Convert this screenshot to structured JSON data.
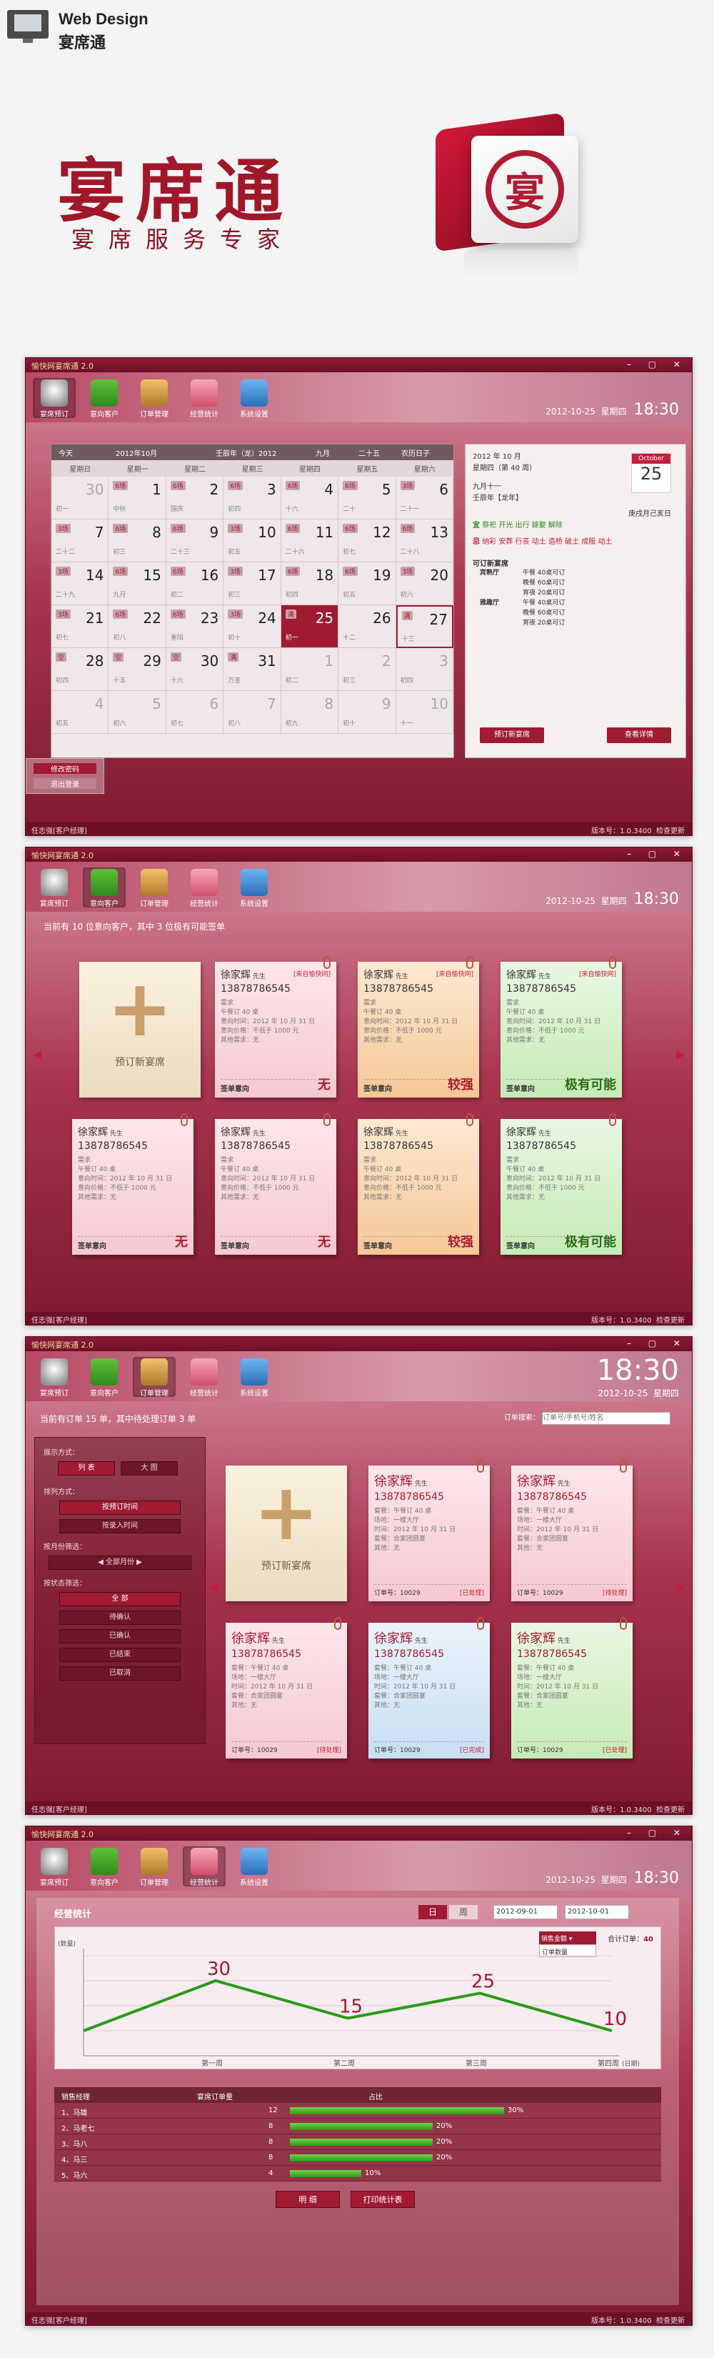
{
  "header": {
    "brand": "Web Design",
    "name": "宴席通"
  },
  "logo": {
    "title": "宴席通",
    "subtitle": "宴席服务专家",
    "seal": "宴"
  },
  "app_title": "愉快网宴席通 2.0",
  "app_title2": "愉快网宴席通 2.0",
  "toolbar": [
    "宴席预订",
    "意向客户",
    "订单管理",
    "经营统计",
    "系统设置"
  ],
  "date": "2012-10-25",
  "weekday": "星期四",
  "time": "18:30",
  "status": {
    "left": "任志强[客户经理]",
    "version": "版本号：1.0.3400",
    "help": "检查更新"
  },
  "calendar": {
    "today_btn": "今天",
    "month": "2012年10月",
    "lunar": "壬辰年（龙）2012",
    "lunar_m": "九月",
    "lunar_d": "二十五",
    "holiday": "农历日子",
    "days": [
      "星期日",
      "星期一",
      "星期二",
      "星期三",
      "星期四",
      "星期五",
      "星期六"
    ],
    "cells": [
      [
        "30",
        "初一",
        ""
      ],
      [
        "1",
        "中秋",
        "6场"
      ],
      [
        "2",
        "国庆",
        "6场"
      ],
      [
        "3",
        "初四",
        "6场"
      ],
      [
        "4",
        "十六",
        "6场"
      ],
      [
        "5",
        "二十",
        "6场"
      ],
      [
        "6",
        "二十一",
        "3场"
      ],
      [
        "7",
        "二十二",
        "3场"
      ],
      [
        "8",
        "初三",
        "6场"
      ],
      [
        "9",
        "二十三",
        "6场"
      ],
      [
        "10",
        "初五",
        "3场"
      ],
      [
        "11",
        "二十六",
        "6场"
      ],
      [
        "12",
        "初七",
        "6场"
      ],
      [
        "13",
        "二十八",
        "6场"
      ],
      [
        "14",
        "二十九",
        "3场"
      ],
      [
        "15",
        "九月",
        "6场"
      ],
      [
        "16",
        "初二",
        "6场"
      ],
      [
        "17",
        "初三",
        "3场"
      ],
      [
        "18",
        "初四",
        "6场"
      ],
      [
        "19",
        "初五",
        "6场"
      ],
      [
        "20",
        "初六",
        "3场"
      ],
      [
        "21",
        "初七",
        "3场"
      ],
      [
        "22",
        "初八",
        "6场"
      ],
      [
        "23",
        "重阳",
        "6场"
      ],
      [
        "24",
        "初十",
        "3场"
      ],
      [
        "25",
        "初一",
        "满"
      ],
      [
        "26",
        "十二",
        ""
      ],
      [
        "27",
        "十三",
        "满"
      ],
      [
        "28",
        "初四",
        "空"
      ],
      [
        "29",
        "十五",
        "空"
      ],
      [
        "30",
        "十六",
        "空"
      ],
      [
        "31",
        "万圣",
        "满"
      ],
      [
        "1",
        "初二",
        ""
      ],
      [
        "2",
        "初三",
        ""
      ],
      [
        "3",
        "初四",
        ""
      ],
      [
        "4",
        "初五",
        ""
      ],
      [
        "5",
        "初六",
        ""
      ],
      [
        "6",
        "初七",
        ""
      ],
      [
        "7",
        "初八",
        ""
      ],
      [
        "8",
        "初九",
        ""
      ],
      [
        "9",
        "初十",
        ""
      ],
      [
        "10",
        "十一",
        ""
      ]
    ],
    "tip1": "修改密码",
    "tip2": "退出登录"
  },
  "side": {
    "date": "2012 年    10 月",
    "week": "星期四（第 40 周）",
    "lunar": "九月十一",
    "gz": "壬辰年【龙年】",
    "gz2": "庚戌月己亥日",
    "pad_m": "October",
    "pad_d": "25",
    "yi": "宜",
    "yi_text": "祭祀 开光 出行 嫁娶 解除",
    "ji": "忌",
    "ji_text": "纳彩 安葬 行丧 动土 造桥 破土 成服 动土",
    "hall": "可订新宴席",
    "book_btn": "预订新宴席",
    "view_btn": "查看详情",
    "rooms": [
      [
        "宾熟厅",
        "午餐  40桌可订"
      ],
      [
        "",
        "晚餐  60桌可订"
      ],
      [
        "",
        "宵夜  20桌可订"
      ],
      [
        "雅趣厅",
        "午餐  40桌可订"
      ],
      [
        "",
        "晚餐  60桌可订"
      ],
      [
        "",
        "宵夜  20桌可订"
      ]
    ]
  },
  "customers": {
    "summary": "当前有 10 位意向客户，其中 3 位极有可能签单",
    "add": "预订新宴席",
    "cards": [
      {
        "name": "徐家辉",
        "title": "先生",
        "phone": "13878786545",
        "src": "[来自愉快网]",
        "intent": "无",
        "color": "pink"
      },
      {
        "name": "徐家辉",
        "title": "先生",
        "phone": "13878786545",
        "src": "[来自愉快网]",
        "intent": "较强",
        "color": "orange"
      },
      {
        "name": "徐家辉",
        "title": "先生",
        "phone": "13878786545",
        "src": "[来自愉快网]",
        "intent": "极有可能",
        "color": "green"
      },
      {
        "name": "徐家辉",
        "title": "先生",
        "phone": "13878786545",
        "src": "",
        "intent": "无",
        "color": "pink"
      },
      {
        "name": "徐家辉",
        "title": "先生",
        "phone": "13878786545",
        "src": "",
        "intent": "无",
        "color": "pink"
      },
      {
        "name": "徐家辉",
        "title": "先生",
        "phone": "13878786545",
        "src": "",
        "intent": "较强",
        "color": "orange"
      },
      {
        "name": "徐家辉",
        "title": "先生",
        "phone": "13878786545",
        "src": "",
        "intent": "极有可能",
        "color": "green"
      }
    ],
    "info": [
      "需求",
      "午餐订 40 桌",
      "意向时间：2012 年 10 月 31 日",
      "意向价格：不低于 1000 元",
      "其他需求：无"
    ],
    "foot": "签单意向"
  },
  "orders": {
    "summary": "当前有订单 15 单，其中待处理订单 3 单",
    "search_label": "订单搜索：",
    "search_ph": "订单号/手机号/姓名",
    "f_show": "展示方式：",
    "f_list": "列 表",
    "f_big": "大 图",
    "f_sort": "排列方式：",
    "f_by_time": "按预订时间",
    "f_by_in": "按录入时间",
    "f_month": "按月份筛选：",
    "f_all_month": "全部月份",
    "f_state": "按状态筛选：",
    "states": [
      "全 部",
      "待确认",
      "已确认",
      "已结束",
      "已取消"
    ],
    "add": "预订新宴席",
    "cards": [
      {
        "name": "徐家辉",
        "title": "先生",
        "phone": "13878786545",
        "state": "[已处理]",
        "color": "pink"
      },
      {
        "name": "徐家辉",
        "title": "先生",
        "phone": "13878786545",
        "state": "[待处理]",
        "color": "pink"
      },
      {
        "name": "徐家辉",
        "title": "先生",
        "phone": "13878786545",
        "state": "[待处理]",
        "color": "pink"
      },
      {
        "name": "徐家辉",
        "title": "先生",
        "phone": "13878786545",
        "state": "[已完成]",
        "color": "blue"
      },
      {
        "name": "徐家辉",
        "title": "先生",
        "phone": "13878786545",
        "state": "[已处理]",
        "color": "green"
      }
    ],
    "info": [
      "套餐：午餐订 40 桌",
      "场地：一楼大厅",
      "时间：2012 年 10 月 31 日",
      "套餐：合家团圆宴",
      "其他：无"
    ],
    "order_no": "订单号：10029"
  },
  "stats": {
    "title": "经营统计",
    "tab_day": "日",
    "tab_week": "周",
    "from": "2012-09-01",
    "to": "2012-10-01",
    "sel_label": "销售金额",
    "sel_opt": "订单数量",
    "total_label": "合计订单：",
    "total": "40",
    "ylabel": "(数量)",
    "xlabel": "(日期)",
    "table_head": [
      "销售经理",
      "宴席订单量",
      "占比"
    ],
    "rows": [
      {
        "name": "1、马雄",
        "count": "12",
        "pct": "30%",
        "p": 0.3
      },
      {
        "name": "2、马老七",
        "count": "8",
        "pct": "20%",
        "p": 0.2
      },
      {
        "name": "3、马八",
        "count": "8",
        "pct": "20%",
        "p": 0.2
      },
      {
        "name": "4、马三",
        "count": "8",
        "pct": "20%",
        "p": 0.2
      },
      {
        "name": "5、马六",
        "count": "4",
        "pct": "10%",
        "p": 0.1
      }
    ],
    "btn_detail": "明 细",
    "btn_print": "打印统计表"
  },
  "chart_data": {
    "type": "line",
    "categories": [
      "第一周",
      "第二周",
      "第三周",
      "第四周"
    ],
    "series": [
      {
        "values": [
          10,
          30,
          15,
          25,
          10
        ]
      }
    ],
    "data_labels": [
      "30",
      "15",
      "25",
      "10"
    ],
    "ylim": [
      0,
      40
    ]
  }
}
